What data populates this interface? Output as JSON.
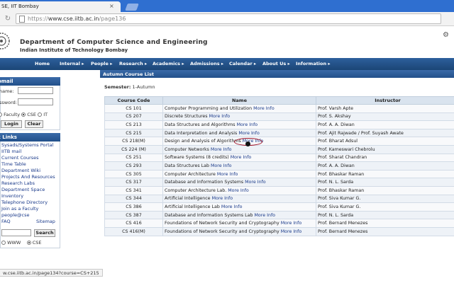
{
  "browser": {
    "tab_title": "SE, IIT Bombay",
    "url_scheme": "https://",
    "url_host": "www.cse.iitb.ac.in",
    "url_path": "/page136"
  },
  "header": {
    "dept": "Department of Computer Science and Engineering",
    "institute": "Indian Institute of Technology Bombay"
  },
  "nav": [
    "Home",
    "Internal ▸",
    "People ▸",
    "Research ▸",
    "Academics ▸",
    "Admissions ▸",
    "Calendar ▸",
    "About Us ▸",
    "Information ▸"
  ],
  "sidebar": {
    "webmail": {
      "title": "ebmail",
      "name_label": "name:",
      "password_label": "ssword:",
      "radio_faculty": "Faculty",
      "radio_cse": "CSE",
      "radio_it": "IT",
      "login": "Login",
      "clear": "Clear"
    },
    "quick_links": {
      "title": "ck Links",
      "items": [
        "Sysads/Systems Portal",
        "IITB mail",
        "Current Courses",
        "Time Table",
        "Department Wiki",
        "Projects And Resources",
        "Research Labs",
        "Department Space",
        "Inventory",
        "Telephone Directory",
        "Join as a Faculty",
        "people@cse"
      ],
      "faq": "FAQ",
      "sitemap": "Sitemap",
      "search": "Search",
      "radio_www": "WWW",
      "radio_cse": "CSE"
    }
  },
  "main": {
    "heading": "Autumn Course List",
    "semester_label": "Semester:",
    "semester_value": "1-Autumn",
    "columns": [
      "Course Code",
      "Name",
      "Instructor"
    ],
    "more_info": "More Info",
    "rows": [
      {
        "code": "CS 101",
        "name": "Computer Programming and Utilization",
        "instructor": "Prof. Varsh Apte"
      },
      {
        "code": "CS 207",
        "name": "Discrete Structures",
        "instructor": "Prof. S. Akshay"
      },
      {
        "code": "CS 213",
        "name": "Data Structures and Algorithms",
        "instructor": "Prof. A. A. Diwan"
      },
      {
        "code": "CS 215",
        "name": "Data Interpretation and Analysis",
        "instructor": "Prof. Ajit Rajwade / Prof. Suyash Awate"
      },
      {
        "code": "CS 218(M)",
        "name": "Design and Analysis of Algorithms",
        "instructor": "Prof. Bharat Adsul"
      },
      {
        "code": "CS 224 (M)",
        "name": "Computer Networks",
        "instructor": "Prof. Kameswari Chebrolu"
      },
      {
        "code": "CS 251",
        "name": "Software Systems (8 credits)",
        "instructor": "Prof. Sharat Chandran"
      },
      {
        "code": "CS 293",
        "name": "Data Structures Lab",
        "instructor": "Prof. A. A. Diwan"
      },
      {
        "code": "CS 305",
        "name": "Computer Architecture",
        "instructor": "Prof. Bhaskar Raman"
      },
      {
        "code": "CS 317",
        "name": "Database and Information Systems",
        "instructor": "Prof. N. L. Sarda"
      },
      {
        "code": "CS 341",
        "name": "Computer Architecture Lab.",
        "instructor": "Prof. Bhaskar Raman"
      },
      {
        "code": "CS 344",
        "name": "Artificial Intelligence",
        "instructor": "Prof. Siva Kumar G."
      },
      {
        "code": "CS 386",
        "name": "Artificial Intelligence Lab",
        "instructor": "Prof. Siva Kumar G."
      },
      {
        "code": "CS 387",
        "name": "Database and Information Systems Lab",
        "instructor": "Prof. N. L. Sarda"
      },
      {
        "code": "CS 416",
        "name": "Foundations of Network Security and Cryptography",
        "instructor": "Prof. Bernard Menezes"
      },
      {
        "code": "CS 416(M)",
        "name": "Foundations of Network Security and Cryptography",
        "instructor": "Prof. Bernard Menezes"
      }
    ]
  },
  "status_bar": "w.cse.iitb.ac.in/page134?course=CS+215"
}
